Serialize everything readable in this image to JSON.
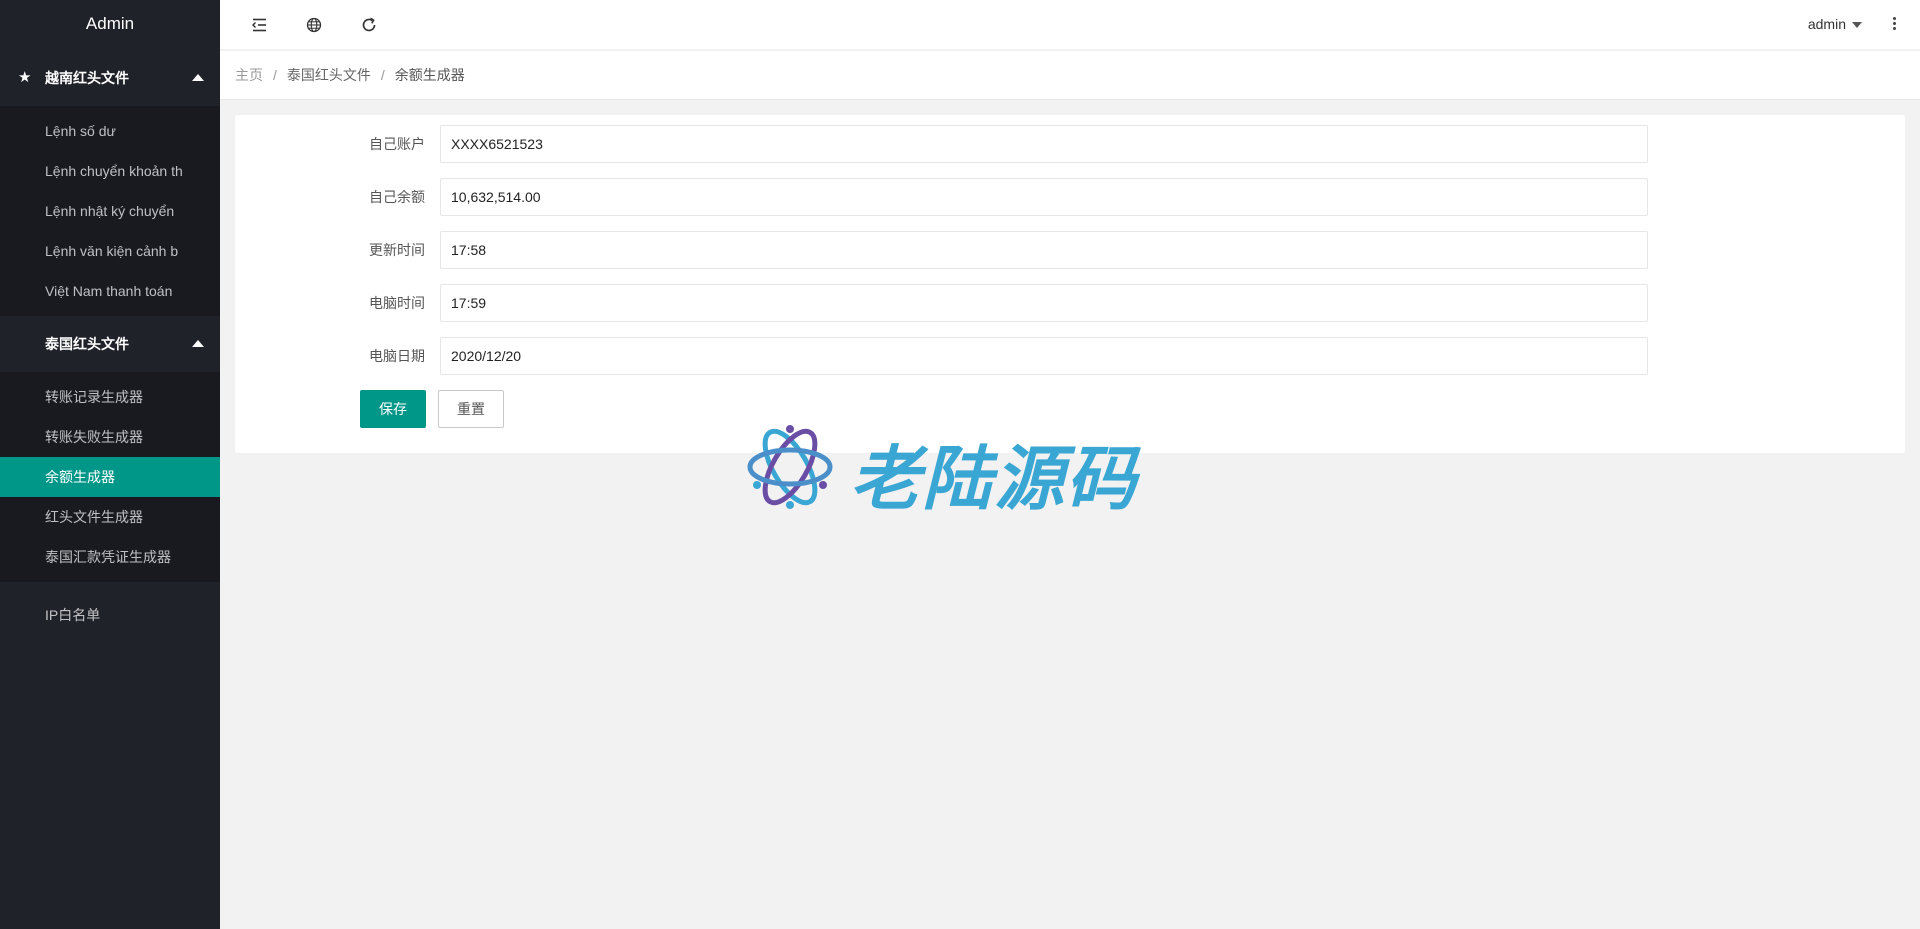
{
  "app": {
    "title": "Admin"
  },
  "sidebar": {
    "groups": [
      {
        "title": "越南红头文件",
        "items": [
          {
            "label": "Lệnh số dư"
          },
          {
            "label": "Lệnh chuyển khoản th"
          },
          {
            "label": "Lệnh nhật ký chuyển"
          },
          {
            "label": "Lệnh văn kiện cảnh b"
          },
          {
            "label": "Việt Nam thanh toán"
          }
        ]
      },
      {
        "title": "泰国红头文件",
        "items": [
          {
            "label": "转账记录生成器"
          },
          {
            "label": "转账失败生成器"
          },
          {
            "label": "余额生成器"
          },
          {
            "label": "红头文件生成器"
          },
          {
            "label": "泰国汇款凭证生成器"
          }
        ]
      }
    ],
    "single": {
      "label": "IP白名单"
    },
    "active_item": "余额生成器",
    "accent_color": "#009688",
    "bg_color": "#20222a"
  },
  "header": {
    "icons": [
      "menu-fold-icon",
      "globe-icon",
      "refresh-icon"
    ],
    "user": "admin",
    "more_icon": "more-vertical-icon"
  },
  "breadcrumb": {
    "items": [
      "主页",
      "泰国红头文件",
      "余额生成器"
    ],
    "separator": "/"
  },
  "form": {
    "fields": [
      {
        "label": "自己账户",
        "value": "XXXX6521523"
      },
      {
        "label": "自己余额",
        "value": "10,632,514.00"
      },
      {
        "label": "更新时间",
        "value": "17:58"
      },
      {
        "label": "电脑时间",
        "value": "17:59"
      },
      {
        "label": "电脑日期",
        "value": "2020/12/20"
      }
    ],
    "save_label": "保存",
    "reset_label": "重置"
  },
  "watermark": {
    "text": "老陆源码"
  }
}
